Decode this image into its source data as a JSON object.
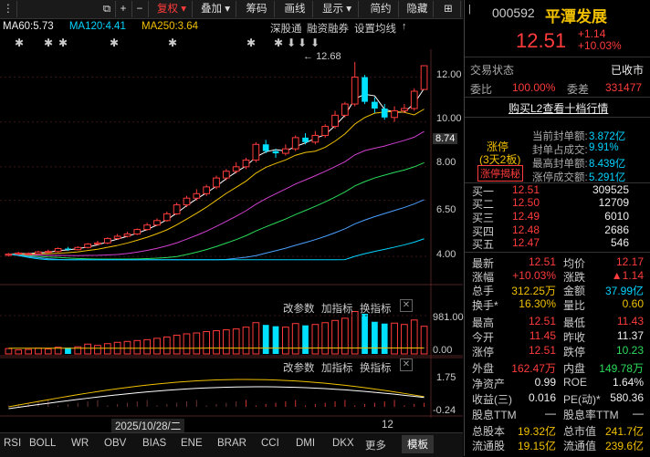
{
  "toolbar": {
    "fuquan": "复权",
    "diejia": "叠加",
    "chouma": "筹码",
    "huaxian": "画线",
    "xianshi": "显示",
    "jiandu": "简约",
    "yinbao": "隐藏"
  },
  "ma": {
    "ma60": "MA60:5.73",
    "ma120": "MA120:4.41",
    "ma250": "MA250:3.64"
  },
  "chart_links": {
    "shenyuan": "深股通",
    "rongzi": "融资融券",
    "settings": "设置均线"
  },
  "price_axis": {
    "p1268": "12.68",
    "p1200": "12.00",
    "p1000": "10.00",
    "p874": "8.74",
    "p800": "8.00",
    "p650": "6.50",
    "p400": "4.00"
  },
  "vol_panel": {
    "change_params": "改参数",
    "add_indicator": "加指标",
    "switch_indicator": "换指标",
    "max": "981.00",
    "zero": "0.00"
  },
  "ind_panel": {
    "change_params": "改参数",
    "add_indicator": "加指标",
    "switch_indicator": "换指标",
    "top": "1.75",
    "bottom": "-0.24"
  },
  "date_label": "2025/10/28/二",
  "date_right": "12",
  "tabs": [
    "RSI",
    "BOLL",
    "WR",
    "OBV",
    "BIAS",
    "ENE",
    "BRAR",
    "CCI",
    "DMI",
    "DKX",
    "更多",
    "模板"
  ],
  "stock": {
    "code": "000592",
    "name": "平潭发展",
    "price": "12.51",
    "change": "+1.14",
    "change_pct": "+10.03%"
  },
  "status": {
    "label": "交易状态",
    "value": "已收市",
    "weibi_label": "委比",
    "weibi": "100.00%",
    "weicha_label": "委差",
    "weicha": "331477",
    "buy_l2": "购买L2查看十档行情"
  },
  "zhangting": {
    "title": "涨停",
    "sub": "(3天2板)",
    "reveal": "涨停揭秘",
    "rows": [
      {
        "label": "当前封单额:",
        "value": "3.872亿"
      },
      {
        "label": "封单占成交:",
        "value": "9.91%"
      },
      {
        "label": "最高封单额:",
        "value": "8.439亿"
      },
      {
        "label": "涨停成交额:",
        "value": "5.291亿"
      }
    ]
  },
  "bids": [
    {
      "label": "买一",
      "price": "12.51",
      "vol": "309525"
    },
    {
      "label": "买二",
      "price": "12.50",
      "vol": "12709"
    },
    {
      "label": "买三",
      "price": "12.49",
      "vol": "6010"
    },
    {
      "label": "买四",
      "price": "12.48",
      "vol": "2686"
    },
    {
      "label": "买五",
      "price": "12.47",
      "vol": "546"
    }
  ],
  "stats": {
    "zuixin_l": "最新",
    "zuixin": "12.51",
    "junjia_l": "均价",
    "junjia": "12.17",
    "zhangfu_l": "涨幅",
    "zhangfu": "+10.03%",
    "zhangdie_l": "涨跌",
    "zhangdie": "▲1.14",
    "zongshou_l": "总手",
    "zongshou": "312.25万",
    "jine_l": "金额",
    "jine": "37.99亿",
    "huanshou_l": "换手*",
    "huanshou": "16.30%",
    "liangbi_l": "量比",
    "liangbi": "0.60",
    "zuigao_l": "最高",
    "zuigao": "12.51",
    "zuidi_l": "最低",
    "zuidi": "11.43",
    "jinkai_l": "今开",
    "jinkai": "11.45",
    "zuoshou_l": "昨收",
    "zuoshou": "11.37",
    "zhangting_l": "涨停",
    "zhangting": "12.51",
    "dieting_l": "跌停",
    "dieting": "10.23",
    "waipan_l": "外盘",
    "waipan": "162.47万",
    "neipan_l": "内盘",
    "neipan": "149.78万",
    "jingzichan_l": "净资产",
    "jingzichan": "0.99",
    "roe_l": "ROE",
    "roe": "1.64%",
    "shouyi_l": "收益(三)",
    "shouyi": "0.016",
    "pe_l": "PE(动)*",
    "pe": "580.36",
    "guxi_l": "股息TTM",
    "guxi": "—",
    "guxilv_l": "股息率TTM",
    "guxilv": "—",
    "zongguben_l": "总股本",
    "zongguben": "19.32亿",
    "zongshizhi_l": "总市值",
    "zongshizhi": "241.7亿",
    "liutong_l": "流通股",
    "liutong": "19.15亿",
    "liutongzhi_l": "流通值",
    "liutongzhi": "239.6亿"
  },
  "colors": {
    "up": "#ff3b3b",
    "down": "#00e0ff",
    "ma60": "#ffffff",
    "ma120": "#00d4ff",
    "ma250": "#f0c000"
  },
  "chart_data": {
    "type": "candlestick",
    "price_range": [
      3.8,
      13.0
    ],
    "candles": [
      {
        "o": 4.05,
        "c": 4.1,
        "h": 4.15,
        "l": 4.0,
        "v": 120
      },
      {
        "o": 4.1,
        "c": 4.15,
        "h": 4.2,
        "l": 4.05,
        "v": 90
      },
      {
        "o": 4.1,
        "c": 4.12,
        "h": 4.18,
        "l": 4.05,
        "v": 100
      },
      {
        "o": 4.12,
        "c": 4.2,
        "h": 4.25,
        "l": 4.08,
        "v": 130
      },
      {
        "o": 4.2,
        "c": 4.22,
        "h": 4.3,
        "l": 4.15,
        "v": 110
      },
      {
        "o": 4.22,
        "c": 4.35,
        "h": 4.4,
        "l": 4.18,
        "v": 150
      },
      {
        "o": 4.35,
        "c": 4.3,
        "h": 4.42,
        "l": 4.25,
        "v": 140
      },
      {
        "o": 4.3,
        "c": 4.4,
        "h": 4.45,
        "l": 4.28,
        "v": 160
      },
      {
        "o": 4.4,
        "c": 4.55,
        "h": 4.6,
        "l": 4.35,
        "v": 220
      },
      {
        "o": 4.55,
        "c": 4.6,
        "h": 4.7,
        "l": 4.5,
        "v": 190
      },
      {
        "o": 4.6,
        "c": 4.8,
        "h": 4.85,
        "l": 4.55,
        "v": 230
      },
      {
        "o": 4.8,
        "c": 4.9,
        "h": 5.0,
        "l": 4.75,
        "v": 260
      },
      {
        "o": 4.9,
        "c": 5.0,
        "h": 5.1,
        "l": 4.85,
        "v": 280
      },
      {
        "o": 5.0,
        "c": 5.2,
        "h": 5.25,
        "l": 4.95,
        "v": 300
      },
      {
        "o": 5.2,
        "c": 5.4,
        "h": 5.5,
        "l": 5.15,
        "v": 320
      },
      {
        "o": 5.4,
        "c": 5.6,
        "h": 5.7,
        "l": 5.35,
        "v": 350
      },
      {
        "o": 5.6,
        "c": 5.9,
        "h": 6.0,
        "l": 5.55,
        "v": 380
      },
      {
        "o": 5.9,
        "c": 6.3,
        "h": 6.4,
        "l": 5.85,
        "v": 420
      },
      {
        "o": 6.3,
        "c": 6.6,
        "h": 6.7,
        "l": 6.2,
        "v": 450
      },
      {
        "o": 6.6,
        "c": 6.8,
        "h": 7.0,
        "l": 6.5,
        "v": 470
      },
      {
        "o": 6.8,
        "c": 7.1,
        "h": 7.2,
        "l": 6.7,
        "v": 500
      },
      {
        "o": 7.1,
        "c": 7.5,
        "h": 7.6,
        "l": 7.0,
        "v": 520
      },
      {
        "o": 7.5,
        "c": 7.8,
        "h": 7.9,
        "l": 7.4,
        "v": 540
      },
      {
        "o": 7.8,
        "c": 8.0,
        "h": 8.2,
        "l": 7.7,
        "v": 560
      },
      {
        "o": 8.0,
        "c": 8.3,
        "h": 8.4,
        "l": 7.9,
        "v": 600
      },
      {
        "o": 8.3,
        "c": 9.0,
        "h": 9.1,
        "l": 8.2,
        "v": 700
      },
      {
        "o": 9.0,
        "c": 8.7,
        "h": 9.2,
        "l": 8.6,
        "v": 650
      },
      {
        "o": 8.7,
        "c": 8.6,
        "h": 8.8,
        "l": 8.4,
        "v": 620
      },
      {
        "o": 8.6,
        "c": 8.8,
        "h": 9.0,
        "l": 8.5,
        "v": 600
      },
      {
        "o": 8.8,
        "c": 9.3,
        "h": 9.4,
        "l": 8.7,
        "v": 680
      },
      {
        "o": 9.3,
        "c": 9.1,
        "h": 9.5,
        "l": 9.0,
        "v": 640
      },
      {
        "o": 9.1,
        "c": 9.4,
        "h": 9.6,
        "l": 9.0,
        "v": 660
      },
      {
        "o": 9.4,
        "c": 9.8,
        "h": 9.9,
        "l": 9.3,
        "v": 700
      },
      {
        "o": 9.8,
        "c": 10.3,
        "h": 10.5,
        "l": 9.7,
        "v": 750
      },
      {
        "o": 10.3,
        "c": 10.8,
        "h": 10.9,
        "l": 10.2,
        "v": 800
      },
      {
        "o": 10.8,
        "c": 12.0,
        "h": 12.68,
        "l": 10.7,
        "v": 950
      },
      {
        "o": 12.0,
        "c": 10.9,
        "h": 12.1,
        "l": 10.8,
        "v": 900
      },
      {
        "o": 10.9,
        "c": 10.6,
        "h": 11.1,
        "l": 10.4,
        "v": 720
      },
      {
        "o": 10.6,
        "c": 10.2,
        "h": 10.8,
        "l": 10.1,
        "v": 680
      },
      {
        "o": 10.2,
        "c": 10.5,
        "h": 10.7,
        "l": 10.0,
        "v": 690
      },
      {
        "o": 10.5,
        "c": 10.6,
        "h": 10.8,
        "l": 10.4,
        "v": 660
      },
      {
        "o": 10.6,
        "c": 11.37,
        "h": 11.5,
        "l": 10.5,
        "v": 760
      },
      {
        "o": 11.45,
        "c": 12.51,
        "h": 12.51,
        "l": 11.43,
        "v": 620
      }
    ]
  }
}
